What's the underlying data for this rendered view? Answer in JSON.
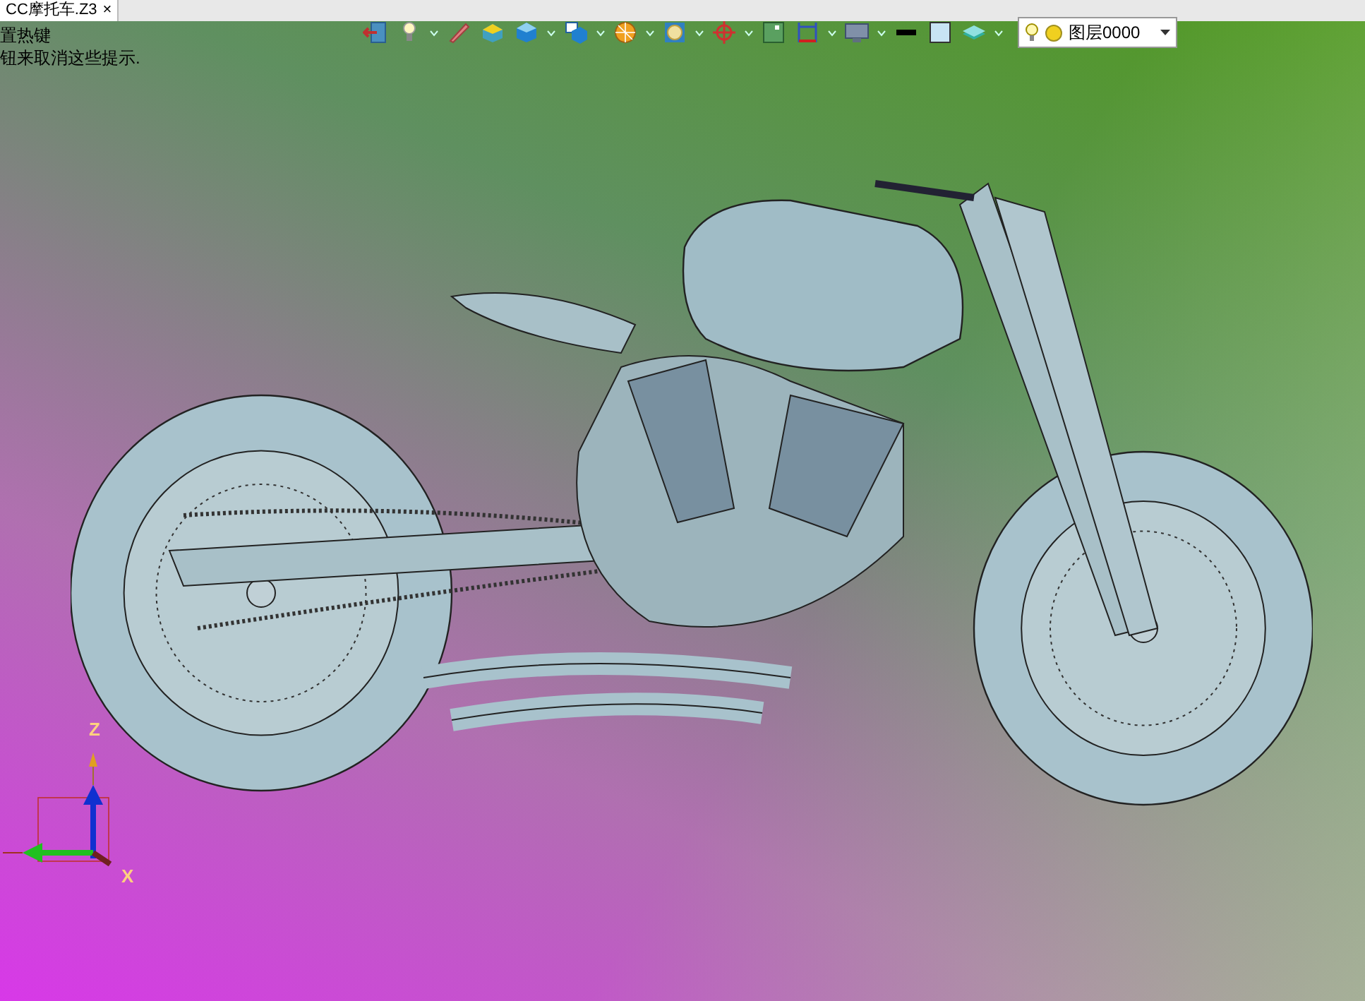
{
  "document_tab": {
    "title": "CC摩托车.Z3",
    "close": "×"
  },
  "hint": {
    "lines": [
      "置热键",
      "钮来取消这些提示."
    ]
  },
  "layer_dropdown": {
    "value": "图层0000"
  },
  "axes": {
    "z_label": "Z",
    "x_label": "X"
  }
}
